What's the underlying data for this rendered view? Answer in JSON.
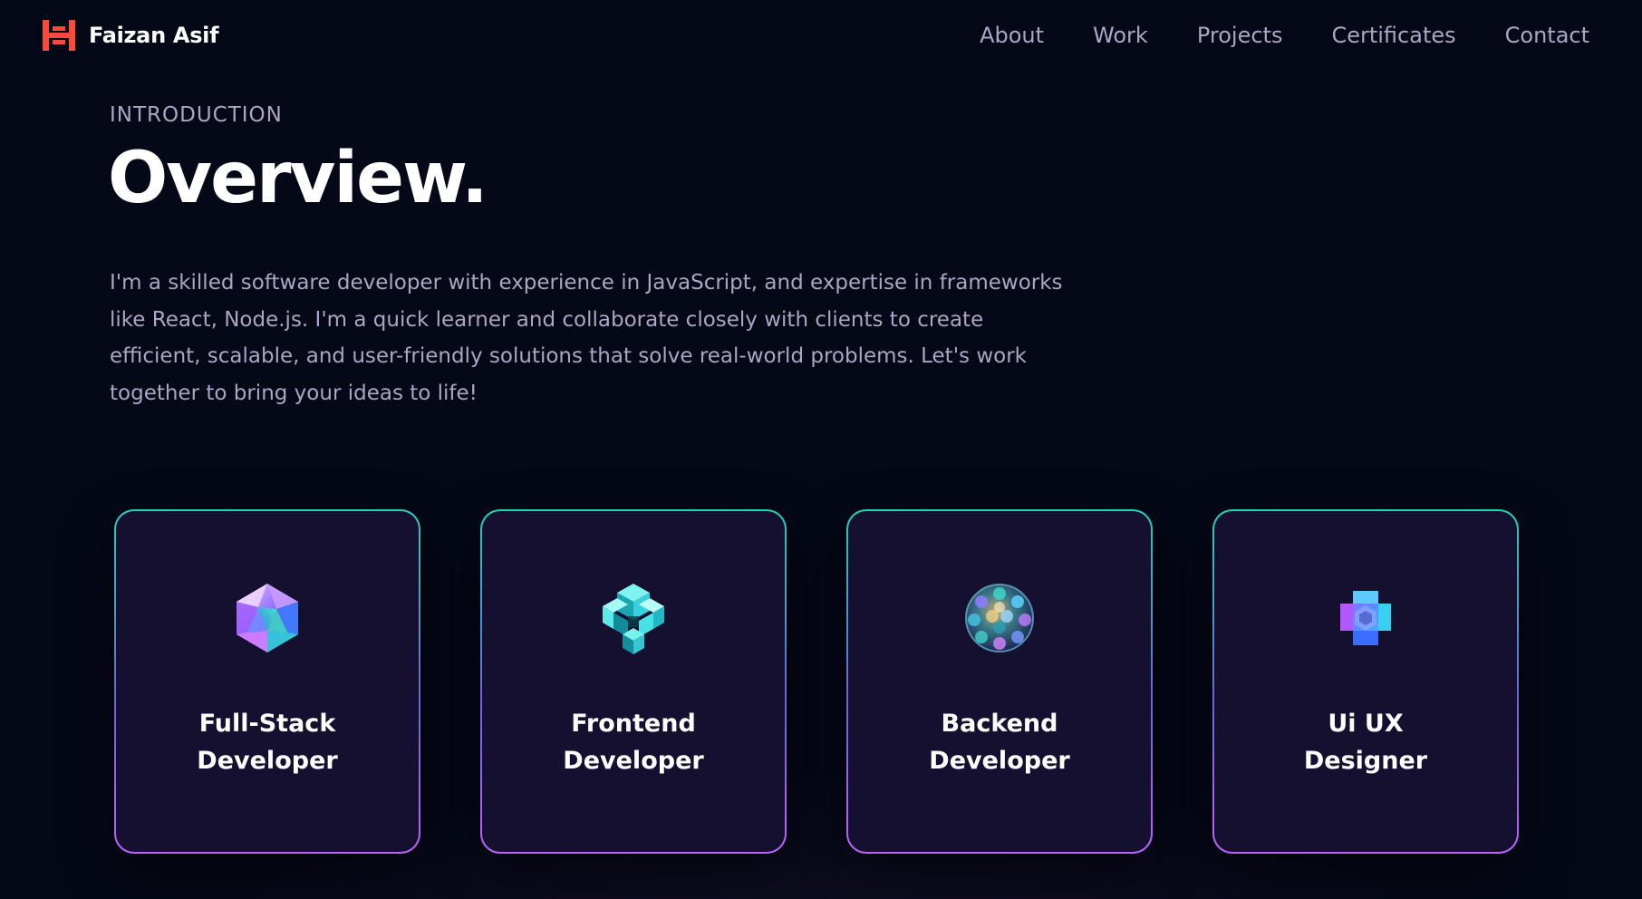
{
  "brand": {
    "name": "Faizan Asif",
    "icon": "logo-icon",
    "accent_color": "#f94a3a"
  },
  "nav": {
    "links": [
      "About",
      "Work",
      "Projects",
      "Certificates",
      "Contact"
    ]
  },
  "overview": {
    "subtitle": "INTRODUCTION",
    "heading": "Overview.",
    "text": "I'm a skilled software developer with experience in JavaScript, and expertise in frameworks like React, Node.js. I'm a quick learner and collaborate closely with clients to create efficient, scalable, and user-friendly solutions that solve real-world problems. Let's work together to bring your ideas to life!"
  },
  "services": [
    {
      "title": "Full-Stack Developer",
      "icon": "icosahedron-icon"
    },
    {
      "title": "Frontend Developer",
      "icon": "cube-cluster-icon"
    },
    {
      "title": "Backend Developer",
      "icon": "sphere-icon"
    },
    {
      "title": "Ui UX Designer",
      "icon": "cross-shape-icon"
    }
  ],
  "colors": {
    "background": "#050816",
    "card": "#151030",
    "secondary_text": "#aaa6c3",
    "border_top": "#1fd3b6",
    "border_bottom": "#bf61ff"
  }
}
